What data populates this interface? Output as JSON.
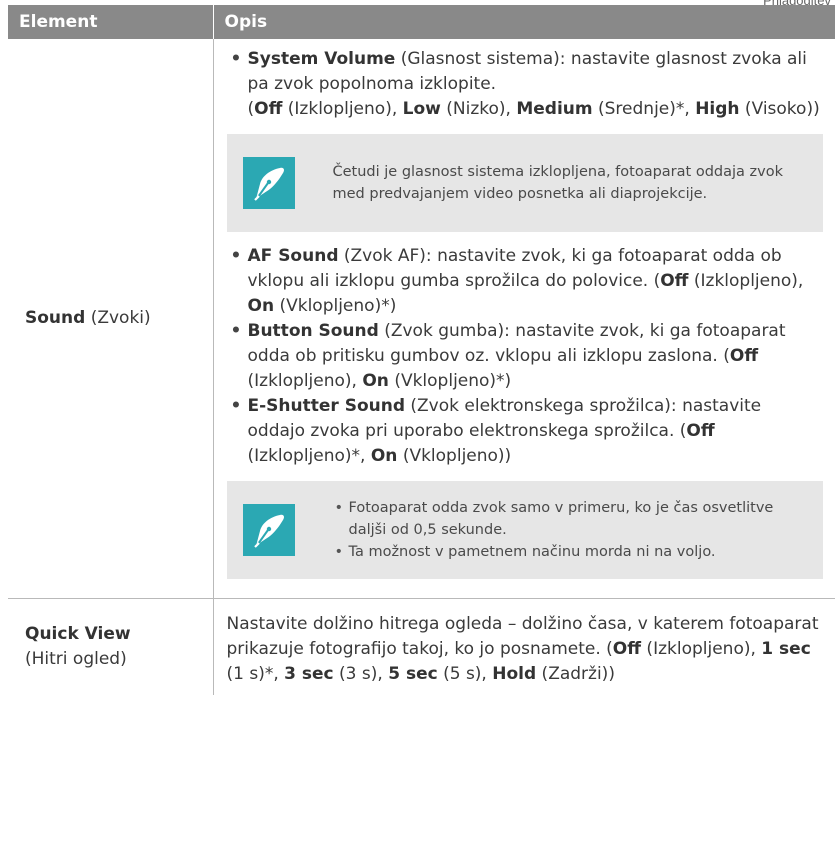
{
  "corner_text": "Prilagoditev",
  "header": {
    "col1": "Element",
    "col2": "Opis"
  },
  "sound_row": {
    "label_bold": "Sound",
    "label_rest": " (Zvoki)",
    "system_volume": {
      "name": "System Volume",
      "t1": " (Glasnost sistema): nastavite glasnost zvoka ali pa zvok popolnoma izklopite.",
      "p_open": "(",
      "off": "Off",
      "t2": " (Izklopljeno), ",
      "low": "Low",
      "t3": " (Nizko), ",
      "medium": "Medium",
      "t4": " (Srednje)*, ",
      "high": "High",
      "t5": " (Visoko))"
    },
    "note1": "Četudi je glasnost sistema izklopljena, fotoaparat oddaja zvok med predvajanjem video posnetka ali diaprojekcije.",
    "af_sound": {
      "name": "AF Sound",
      "t1": " (Zvok AF): nastavite zvok, ki ga fotoaparat odda ob vklopu ali izklopu gumba sprožilca do polovice. (",
      "off": "Off",
      "t2": " (Izklopljeno), ",
      "on": "On",
      "t3": " (Vklopljeno)*)"
    },
    "button_sound": {
      "name": "Button Sound",
      "t1": " (Zvok gumba): nastavite zvok, ki ga fotoaparat odda ob pritisku gumbov oz. vklopu ali izklopu zaslona. (",
      "off": "Off",
      "t2": " (Izklopljeno), ",
      "on": "On",
      "t3": " (Vklopljeno)*)"
    },
    "eshutter_sound": {
      "name": "E-Shutter Sound",
      "t1": " (Zvok elektronskega sprožilca): nastavite oddajo zvoka pri uporabo elektronskega sprožilca. (",
      "off": "Off",
      "t2": " (Izklopljeno)*, ",
      "on": "On",
      "t3": " (Vklopljeno))"
    },
    "note2_items": [
      "Fotoaparat odda zvok samo v primeru, ko je čas osvetlitve daljši od 0,5 sekunde.",
      "Ta možnost v pametnem načinu morda ni na voljo."
    ]
  },
  "quick_row": {
    "label_bold": "Quick View",
    "label_rest": "(Hitri ogled)",
    "t1": "Nastavite dolžino hitrega ogleda – dolžino časa, v katerem fotoaparat prikazuje fotografijo takoj, ko jo posnamete. (",
    "off": "Off",
    "t2": " (Izklopljeno), ",
    "s1": "1 sec",
    "t3": " (1 s)*, ",
    "s3": "3 sec",
    "t4": " (3 s), ",
    "s5": "5 sec",
    "t5": " (5 s), ",
    "hold": "Hold",
    "t6": " (Zadrži))"
  },
  "bullet_glyph": "•",
  "colors": {
    "header_bg": "#898989",
    "note_bg": "#e6e6e6",
    "icon_bg": "#2ba8b3"
  },
  "icon": "pen-nib-note-icon"
}
